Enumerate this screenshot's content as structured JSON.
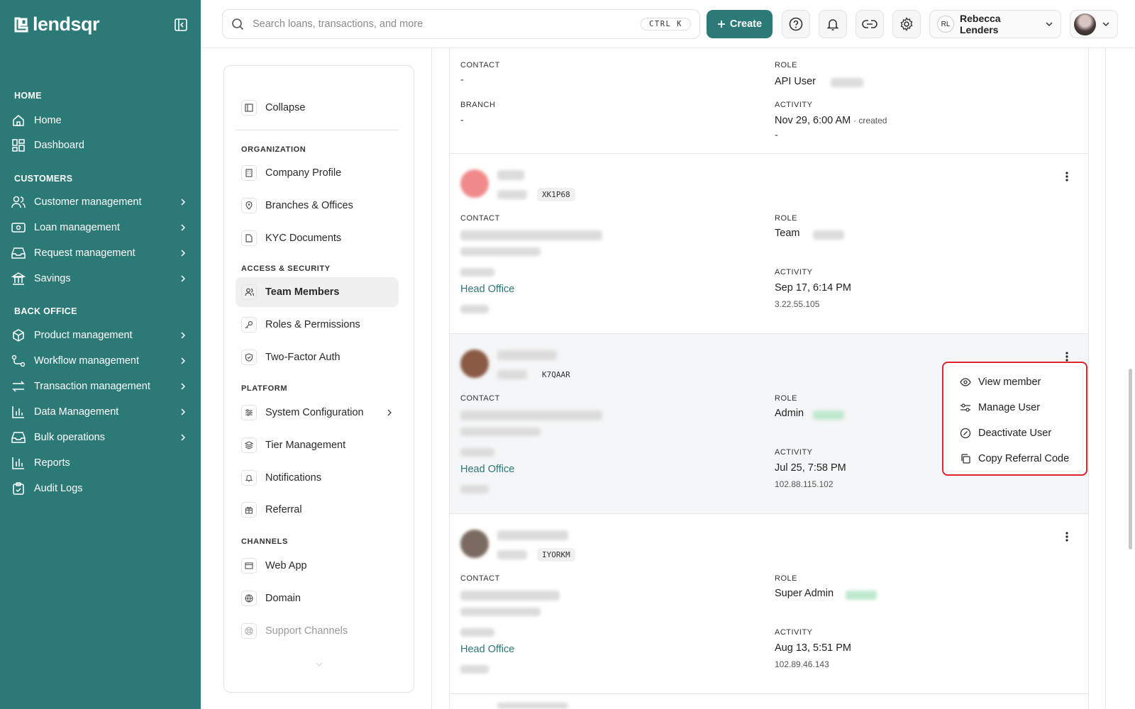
{
  "brand": {
    "name": "lendsqr",
    "color": "#2b7a78"
  },
  "sidebar": {
    "sections": [
      {
        "title": "HOME",
        "items": [
          {
            "label": "Home",
            "icon": "home-icon",
            "has_chevron": false
          },
          {
            "label": "Dashboard",
            "icon": "dashboard-icon",
            "has_chevron": false
          }
        ]
      },
      {
        "title": "CUSTOMERS",
        "items": [
          {
            "label": "Customer management",
            "icon": "users-icon",
            "has_chevron": true
          },
          {
            "label": "Loan management",
            "icon": "money-icon",
            "has_chevron": true
          },
          {
            "label": "Request management",
            "icon": "inbox-icon",
            "has_chevron": true
          },
          {
            "label": "Savings",
            "icon": "bank-icon",
            "has_chevron": true
          }
        ]
      },
      {
        "title": "BACK OFFICE",
        "items": [
          {
            "label": "Product management",
            "icon": "box-icon",
            "has_chevron": true
          },
          {
            "label": "Workflow management",
            "icon": "workflow-icon",
            "has_chevron": true
          },
          {
            "label": "Transaction management",
            "icon": "transfer-icon",
            "has_chevron": true
          },
          {
            "label": "Data Management",
            "icon": "bar-chart-icon",
            "has_chevron": true
          },
          {
            "label": "Bulk operations",
            "icon": "tray-icon",
            "has_chevron": true
          },
          {
            "label": "Reports",
            "icon": "reports-icon",
            "has_chevron": false
          },
          {
            "label": "Audit Logs",
            "icon": "clipboard-icon",
            "has_chevron": false
          }
        ]
      }
    ]
  },
  "topbar": {
    "search_placeholder": "Search loans, transactions, and more",
    "shortcut": "CTRL K",
    "create_label": "Create",
    "user_initials": "RL",
    "user_name": "Rebecca Lenders"
  },
  "settings_nav": {
    "collapse_label": "Collapse",
    "groups": [
      {
        "title": "ORGANIZATION",
        "items": [
          "Company Profile",
          "Branches & Offices",
          "KYC Documents"
        ]
      },
      {
        "title": "ACCESS & SECURITY",
        "items": [
          "Team Members",
          "Roles & Permissions",
          "Two-Factor Auth"
        ]
      },
      {
        "title": "PLATFORM",
        "items": [
          "System Configuration",
          "Tier Management",
          "Notifications",
          "Referral"
        ]
      },
      {
        "title": "CHANNELS",
        "items": [
          "Web App",
          "Domain",
          "Support Channels"
        ]
      }
    ],
    "active_item": "Team Members"
  },
  "members": {
    "labels": {
      "contact": "CONTACT",
      "role": "ROLE",
      "branch": "BRANCH",
      "activity": "ACTIVITY"
    },
    "first": {
      "contact": "-",
      "role": "API User",
      "branch": "-",
      "activity": "Nov 29, 6:00 AM",
      "activity_note": "· created",
      "activity_sub": "-"
    },
    "cards": [
      {
        "code": "XK1P68",
        "role": "Team",
        "branch": "Head Office",
        "activity": "Sep 17, 6:14 PM",
        "ip": "3.22.55.105"
      },
      {
        "code": "K7QAAR",
        "role": "Admin",
        "branch": "Head Office",
        "activity": "Jul 25, 7:58 PM",
        "ip": "102.88.115.102"
      },
      {
        "code": "IYORKM",
        "role": "Super Admin",
        "branch": "Head Office",
        "activity": "Aug 13, 5:51 PM",
        "ip": "102.89.46.143"
      }
    ]
  },
  "row_menu": {
    "items": [
      {
        "label": "View member",
        "icon": "eye-icon"
      },
      {
        "label": "Manage User",
        "icon": "sliders-icon"
      },
      {
        "label": "Deactivate User",
        "icon": "ban-icon"
      },
      {
        "label": "Copy Referral Code",
        "icon": "copy-icon"
      }
    ],
    "highlight_color": "#e0242c"
  }
}
